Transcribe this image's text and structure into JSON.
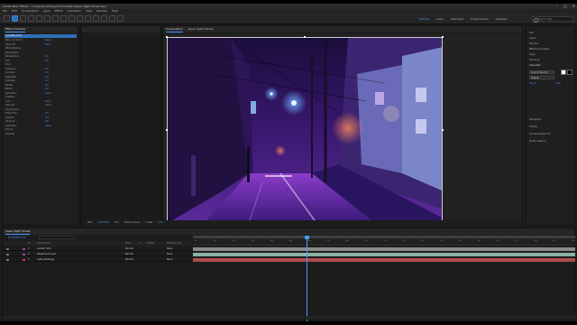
{
  "window": {
    "title": "Adobe After Effects - C:\\Users\\me\\Projects\\Cinematic\\Japan Night Street.aep *",
    "controls": [
      "–",
      "□",
      "✕"
    ]
  },
  "menu": [
    "File",
    "Edit",
    "Composition",
    "Layer",
    "Effect",
    "Animation",
    "View",
    "Window",
    "Help"
  ],
  "workspaces": [
    "Default",
    "Learn",
    "Standard",
    "Small Screen",
    "Libraries"
  ],
  "search_placeholder": "Search Help",
  "effect_controls": {
    "tab": "Effect Controls",
    "layer": "Lumetri Color",
    "rows": [
      {
        "label": "Basic Correction",
        "value": "Reset"
      },
      {
        "label": "Input LUT",
        "value": "None"
      },
      {
        "label": "White Balance",
        "value": ""
      },
      {
        "label": "WB Selector",
        "value": ""
      },
      {
        "label": "Temperature",
        "value": "0.0"
      },
      {
        "label": "Tint",
        "value": "0.0"
      },
      {
        "label": "Tone",
        "value": ""
      },
      {
        "label": "Exposure",
        "value": "0.0"
      },
      {
        "label": "Contrast",
        "value": "0.0"
      },
      {
        "label": "Highlights",
        "value": "0.0"
      },
      {
        "label": "Shadows",
        "value": "0.0"
      },
      {
        "label": "Whites",
        "value": "0.0"
      },
      {
        "label": "Blacks",
        "value": "0.0"
      },
      {
        "label": "Saturation",
        "value": "100.0"
      },
      {
        "label": "Creative",
        "value": ""
      },
      {
        "label": "Look",
        "value": "None"
      },
      {
        "label": "Intensity",
        "value": "100.0"
      },
      {
        "label": "Adjustments",
        "value": ""
      },
      {
        "label": "Faded Film",
        "value": "0.0"
      },
      {
        "label": "Sharpen",
        "value": "0.0"
      },
      {
        "label": "Vibrance",
        "value": "0.0"
      },
      {
        "label": "Saturation",
        "value": "100.0"
      },
      {
        "label": "Curves",
        "value": ""
      },
      {
        "label": "Vignette",
        "value": ""
      }
    ]
  },
  "composition": {
    "tab": "Composition",
    "comp_name": "Japan Night Street",
    "footer": {
      "zoom": "50%",
      "timecode": "0;00;04;12",
      "quality": "Full",
      "camera": "Active Camera",
      "views": "1 View",
      "exposure": "+0.0"
    }
  },
  "right_panel": {
    "sections": [
      "Info",
      "Audio",
      "Preview",
      "Effects & Presets",
      "Align",
      "Libraries",
      "Character",
      "Paragraph",
      "Tracker",
      "Content-Aware Fill",
      "Motion Sketch"
    ],
    "font": "Source Sans Pro",
    "font_style": "Regular",
    "size": "36 px",
    "leading": "Auto",
    "fill_color": "#ffffff",
    "stroke_color": "#000000"
  },
  "timeline": {
    "tab": "Japan Night Street",
    "timecode": "0;00;04;12",
    "columns": [
      "#",
      "Layer Name",
      "Mode",
      "T",
      "TrkMat",
      "Parent & Link"
    ],
    "layers": [
      {
        "num": "1",
        "name": "Lumetri Color",
        "mode": "Normal",
        "parent": "None",
        "label_color": "#a44a8c",
        "bar_color": "#8a8a8a"
      },
      {
        "num": "2",
        "name": "Adjustment Layer",
        "mode": "Normal",
        "parent": "None",
        "label_color": "#a44a8c",
        "bar_color": "#8ab0a0"
      },
      {
        "num": "3",
        "name": "night_street.jpg",
        "mode": "Normal",
        "parent": "None",
        "label_color": "#c44747",
        "bar_color": "#b04b4b"
      }
    ],
    "ruler": [
      "0s",
      "01s",
      "02s",
      "03s",
      "04s",
      "05s",
      "06s",
      "07s",
      "08s",
      "09s",
      "10s",
      "11s",
      "12s",
      "13s",
      "14s",
      "15s",
      "16s",
      "17s",
      "18s",
      "19s",
      "20s"
    ]
  }
}
